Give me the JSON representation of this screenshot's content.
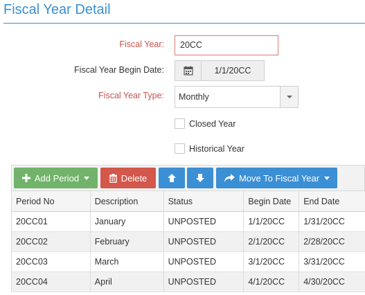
{
  "page": {
    "title": "Fiscal Year Detail"
  },
  "form": {
    "fiscal_year_label": "Fiscal Year:",
    "fiscal_year_value": "20CC",
    "begin_date_label": "Fiscal Year Begin Date:",
    "begin_date_value": "1/1/20CC",
    "type_label": "Fiscal Year Type:",
    "type_value": "Monthly",
    "closed_year_label": "Closed Year",
    "closed_year_checked": false,
    "historical_year_label": "Historical Year",
    "historical_year_checked": false
  },
  "toolbar": {
    "add_period_label": "Add Period",
    "delete_label": "Delete",
    "move_to_fiscal_year_label": "Move To Fiscal Year"
  },
  "grid": {
    "columns": [
      "Period No",
      "Description",
      "Status",
      "Begin Date",
      "End Date"
    ],
    "rows": [
      [
        "20CC01",
        "January",
        "UNPOSTED",
        "1/1/20CC",
        "1/31/20CC"
      ],
      [
        "20CC02",
        "February",
        "UNPOSTED",
        "2/1/20CC",
        "2/28/20CC"
      ],
      [
        "20CC03",
        "March",
        "UNPOSTED",
        "3/1/20CC",
        "3/31/20CC"
      ],
      [
        "20CC04",
        "April",
        "UNPOSTED",
        "4/1/20CC",
        "4/30/20CC"
      ]
    ]
  },
  "colors": {
    "title_blue": "#3a8fd1",
    "required_label_red": "#c9524a",
    "add_green": "#71b36b",
    "delete_red": "#d3574b",
    "action_blue": "#3b8fd4"
  }
}
